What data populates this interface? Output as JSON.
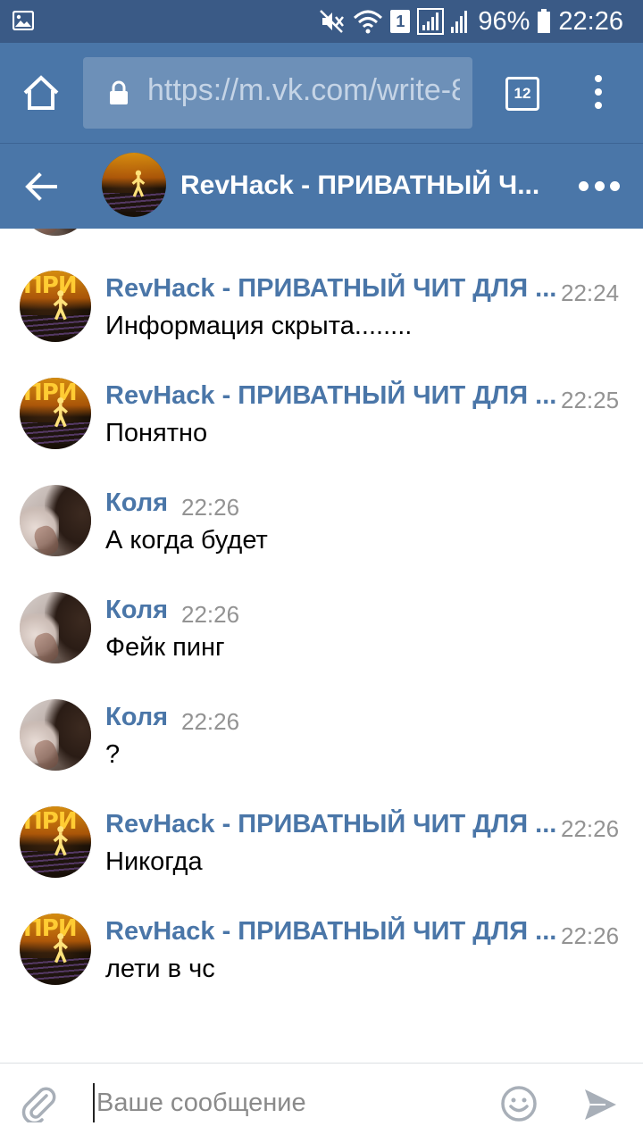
{
  "status_bar": {
    "battery_percent": "96%",
    "time": "22:26",
    "sim_badge": "1",
    "icons": [
      "gallery-icon",
      "mute-icon",
      "wifi-icon",
      "sim-icon",
      "signal-icon",
      "signal-icon",
      "battery-icon"
    ]
  },
  "browser": {
    "url": "https://m.vk.com/write-8",
    "tabs_count": "12",
    "icons": [
      "home-icon",
      "lock-icon",
      "tabs-icon",
      "overflow-menu-icon"
    ]
  },
  "chat": {
    "title": "RevHack - ПРИВАТНЫЙ Ч...",
    "icons": [
      "back-arrow-icon",
      "more-icon"
    ]
  },
  "messages": [
    {
      "author": "RevHack - ПРИВАТНЫЙ ЧИТ ДЛЯ ...",
      "time": "22:24",
      "text": "Информация скрыта........",
      "avatar": "revhack"
    },
    {
      "author": "RevHack - ПРИВАТНЫЙ ЧИТ ДЛЯ ...",
      "time": "22:25",
      "text": "Понятно",
      "avatar": "revhack"
    },
    {
      "author": "Коля",
      "time": "22:26",
      "text": "А когда будет",
      "avatar": "kolya"
    },
    {
      "author": "Коля",
      "time": "22:26",
      "text": "Фейк пинг",
      "avatar": "kolya"
    },
    {
      "author": "Коля",
      "time": "22:26",
      "text": "?",
      "avatar": "kolya"
    },
    {
      "author": "RevHack - ПРИВАТНЫЙ ЧИТ ДЛЯ ...",
      "time": "22:26",
      "text": "Никогда",
      "avatar": "revhack"
    },
    {
      "author": "RevHack - ПРИВАТНЫЙ ЧИТ ДЛЯ ...",
      "time": "22:26",
      "text": "лети в чс",
      "avatar": "revhack"
    }
  ],
  "composer": {
    "placeholder": "Ваше сообщение",
    "icons": [
      "paperclip-icon",
      "emoji-icon",
      "send-icon"
    ]
  },
  "colors": {
    "status_bar": "#3a5a86",
    "toolbar": "#4a76a8",
    "author_link": "#4a76a8",
    "timestamp": "#939393"
  }
}
